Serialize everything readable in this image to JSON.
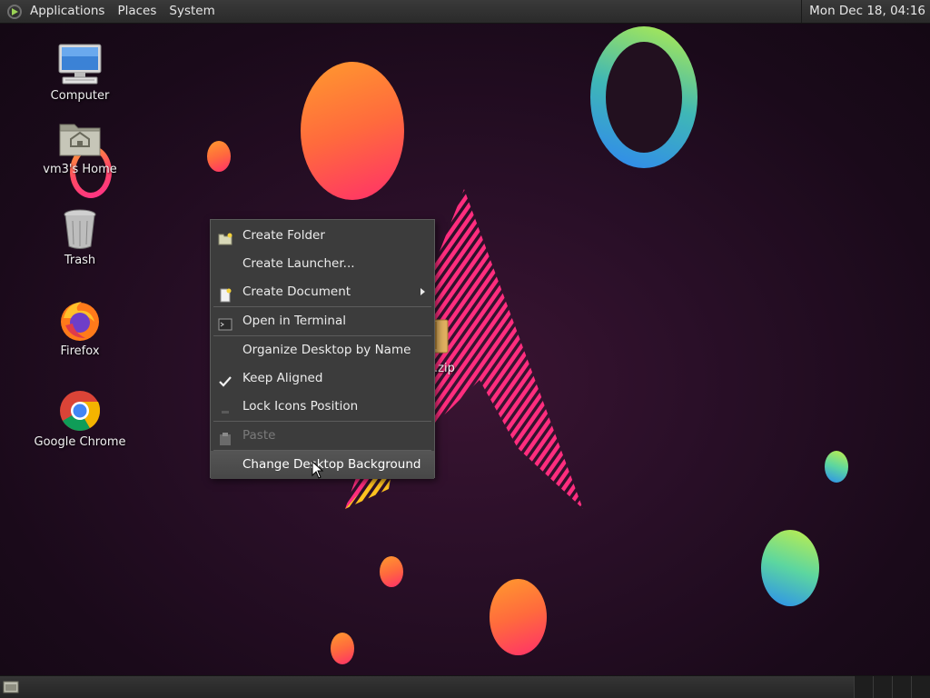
{
  "top_panel": {
    "menus": [
      "Applications",
      "Places",
      "System"
    ],
    "clock": "Mon Dec 18, 04:16"
  },
  "desktop_icons": [
    {
      "label": "Computer",
      "icon": "computer-icon"
    },
    {
      "label": "vm3's Home",
      "icon": "home-folder-icon"
    },
    {
      "label": "Trash",
      "icon": "trash-icon"
    },
    {
      "label": "Firefox",
      "icon": "firefox-icon"
    },
    {
      "label": "Google Chrome",
      "icon": "chrome-icon"
    }
  ],
  "partial_file": {
    "label": ".zip",
    "icon": "zip-archive-icon"
  },
  "context_menu": {
    "items": [
      {
        "label": "Create Folder",
        "icon": "new-folder-icon",
        "enabled": true
      },
      {
        "label": "Create Launcher...",
        "icon": "",
        "enabled": true
      },
      {
        "label": "Create Document",
        "icon": "new-document-icon",
        "enabled": true,
        "submenu": true
      },
      {
        "label": "Open in Terminal",
        "icon": "terminal-icon",
        "enabled": true
      },
      {
        "label": "Organize Desktop by Name",
        "icon": "",
        "enabled": true
      },
      {
        "label": "Keep Aligned",
        "icon": "checkmark-icon",
        "enabled": true,
        "checked": true
      },
      {
        "label": "Lock Icons Position",
        "icon": "lock-icon",
        "enabled": true
      },
      {
        "label": "Paste",
        "icon": "paste-icon",
        "enabled": false
      },
      {
        "label": "Change Desktop Background",
        "icon": "",
        "enabled": true,
        "hovered": true
      }
    ]
  },
  "colors": {
    "panel": "#2f2f2f",
    "menu_bg": "#3c3c3c",
    "accent_warm": "#ff6a3d",
    "accent_pink": "#ff2f8a",
    "accent_cool": "#2a8df0"
  }
}
